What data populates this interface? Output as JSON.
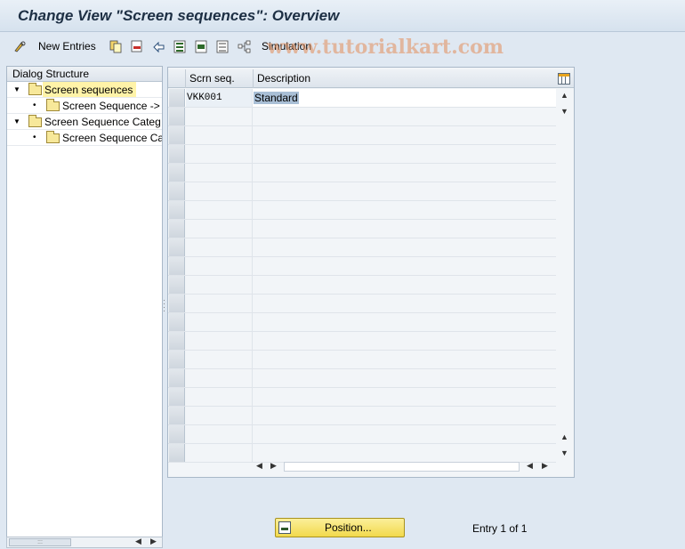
{
  "window": {
    "title": "Change View \"Screen sequences\": Overview"
  },
  "toolbar": {
    "new_entries_label": "New Entries",
    "simulation_label": "Simulation",
    "icons": [
      "edit-glasses-icon",
      "copy-icon",
      "delete-icon",
      "undo-icon",
      "select-all-icon",
      "select-block-icon",
      "deselect-all-icon",
      "simulation-icon"
    ]
  },
  "watermark": "www.tutorialkart.com",
  "dialog_structure": {
    "header": "Dialog Structure",
    "items": [
      {
        "label": "Screen sequences",
        "level": 0,
        "expanded": true,
        "selected": true
      },
      {
        "label": "Screen Sequence ->",
        "level": 1
      },
      {
        "label": "Screen Sequence Categ",
        "level": 0,
        "expanded": true
      },
      {
        "label": "Screen Sequence Ca",
        "level": 1
      }
    ]
  },
  "table": {
    "columns": [
      "Scrn seq.",
      "Description"
    ],
    "rows": [
      {
        "seq": "VKK001",
        "description": "Standard"
      }
    ],
    "empty_rows": 19
  },
  "footer": {
    "position_button": "Position...",
    "entry_info": "Entry 1 of 1"
  },
  "colors": {
    "background": "#dfe8f2",
    "selected_tree": "#fff3a8",
    "position_button": "#f2d94c"
  }
}
